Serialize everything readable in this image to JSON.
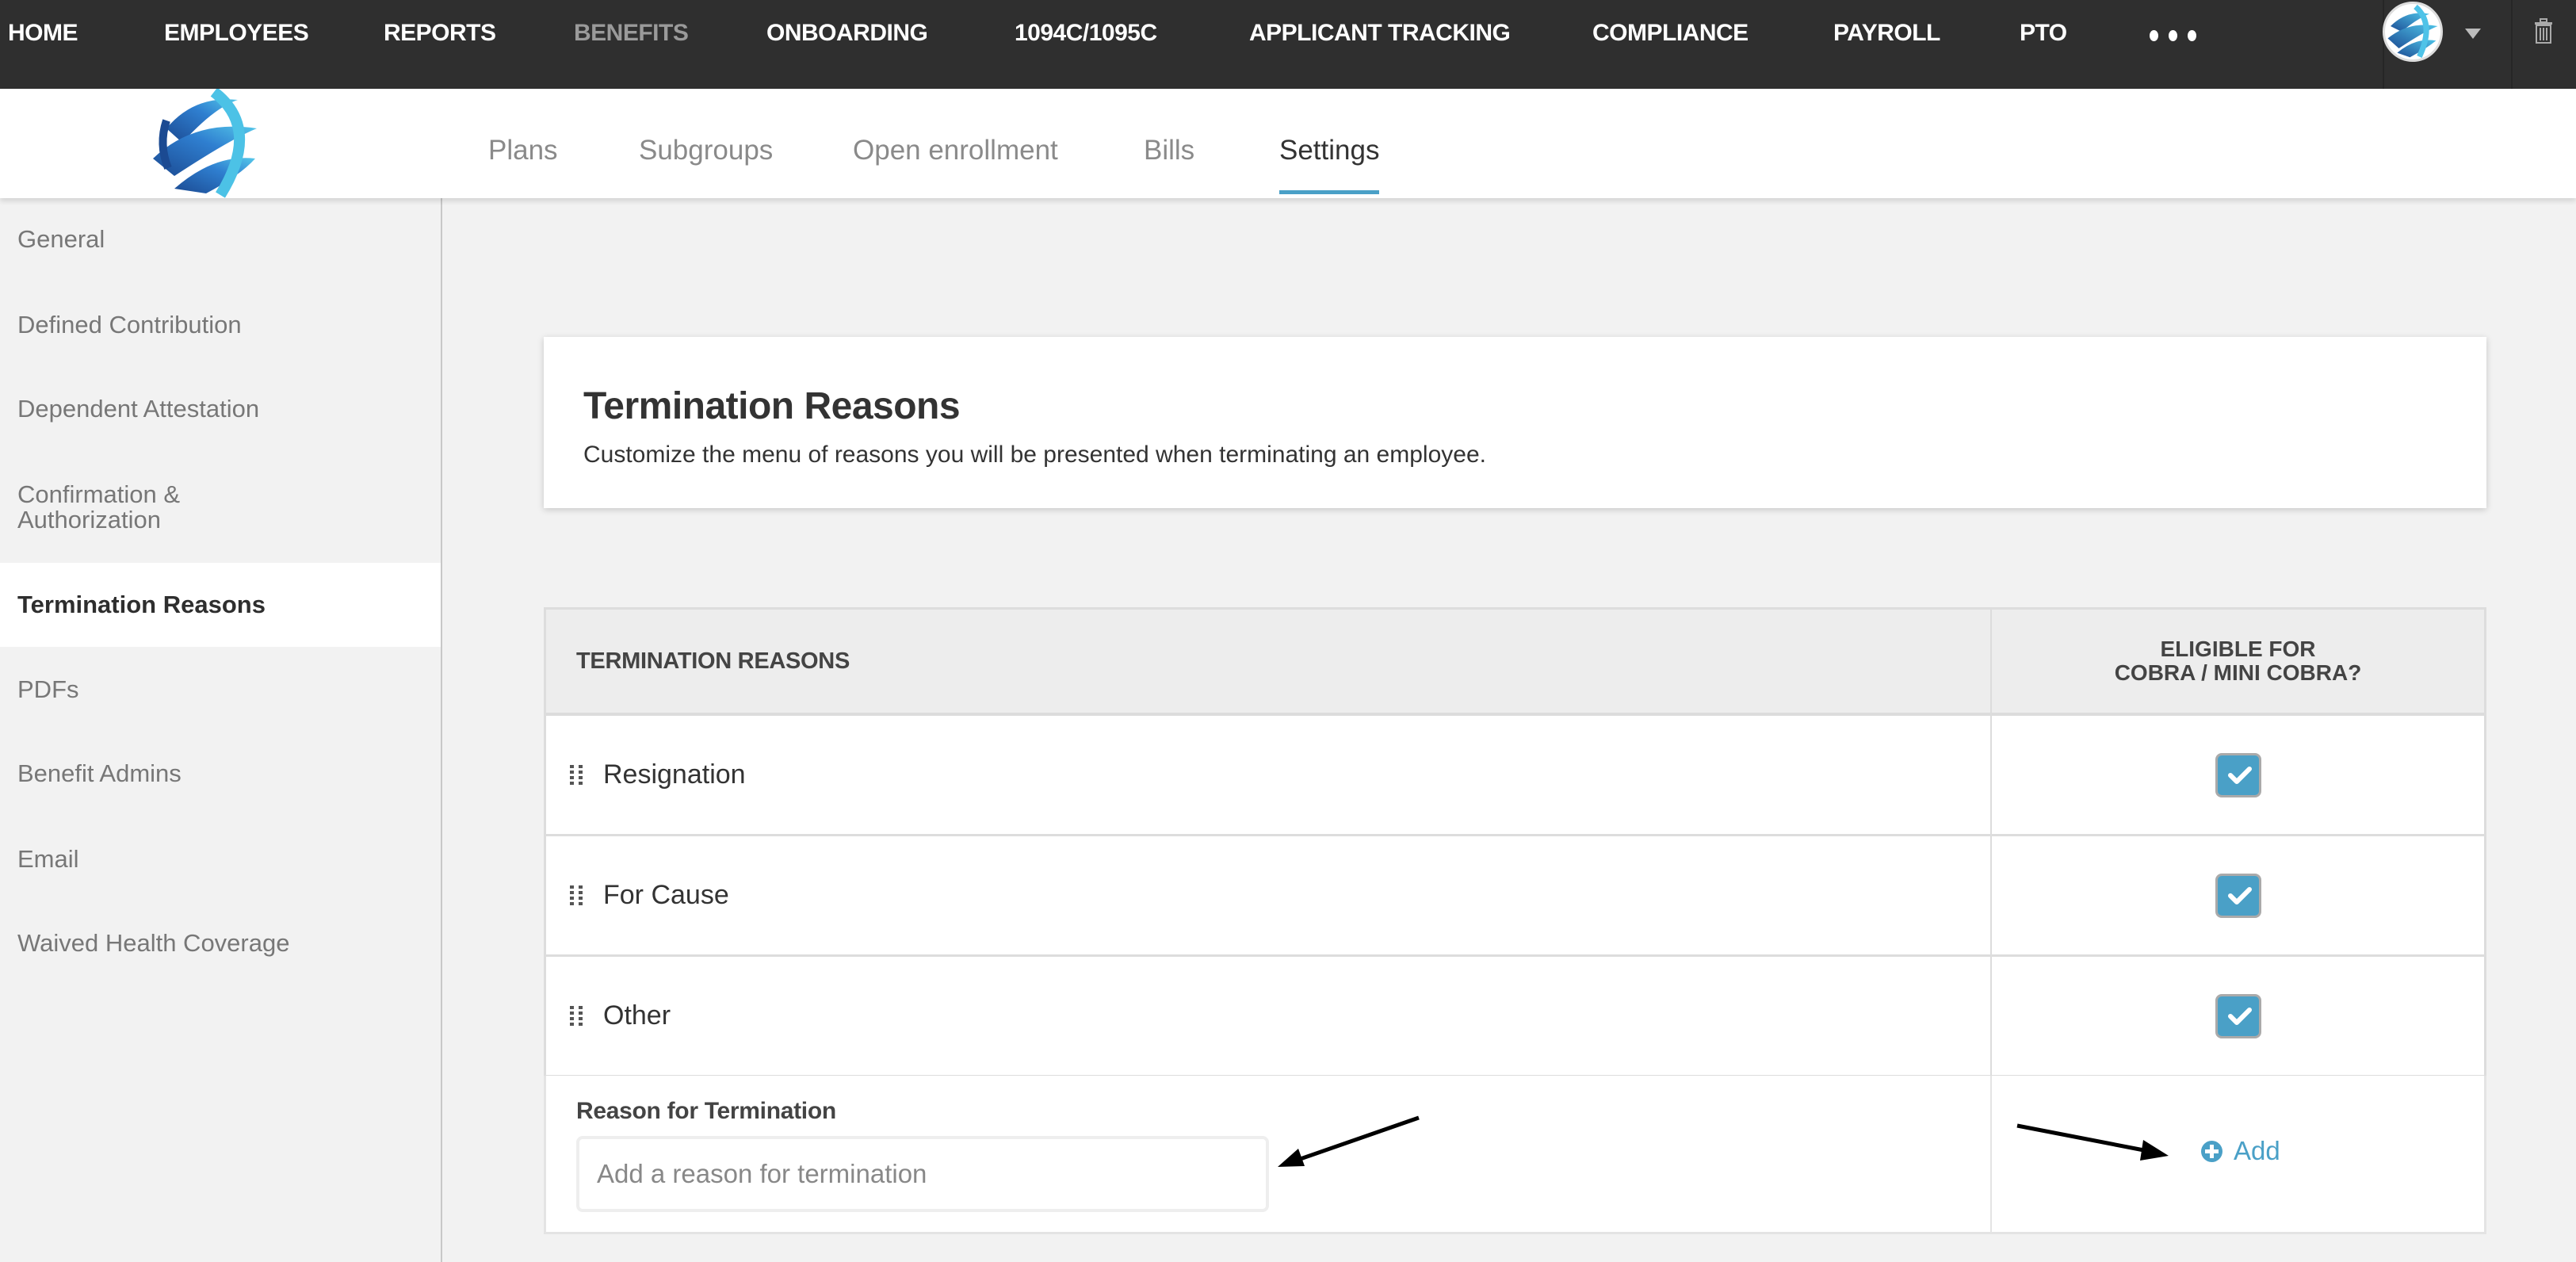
{
  "topnav": {
    "items": [
      {
        "label": "HOME",
        "active": false
      },
      {
        "label": "EMPLOYEES",
        "active": false
      },
      {
        "label": "REPORTS",
        "active": false
      },
      {
        "label": "BENEFITS",
        "active": true
      },
      {
        "label": "ONBOARDING",
        "active": false
      },
      {
        "label": "1094C/1095C",
        "active": false
      },
      {
        "label": "APPLICANT TRACKING",
        "active": false
      },
      {
        "label": "COMPLIANCE",
        "active": false
      },
      {
        "label": "PAYROLL",
        "active": false
      },
      {
        "label": "PTO",
        "active": false
      }
    ],
    "more_icon": "ellipsis-icon",
    "user_icon": "avatar-globe-icon",
    "dropdown_icon": "caret-down-icon",
    "trash_icon": "trash-icon"
  },
  "subnav": {
    "logo_icon": "globe-logo-icon",
    "tabs": [
      {
        "label": "Plans",
        "active": false
      },
      {
        "label": "Subgroups",
        "active": false
      },
      {
        "label": "Open enrollment",
        "active": false
      },
      {
        "label": "Bills",
        "active": false
      },
      {
        "label": "Settings",
        "active": true
      }
    ]
  },
  "sidebar": {
    "items": [
      {
        "label": "General",
        "active": false
      },
      {
        "label": "Defined Contribution",
        "active": false
      },
      {
        "label": "Dependent Attestation",
        "active": false
      },
      {
        "label": "Confirmation & Authorization",
        "active": false
      },
      {
        "label": "Termination Reasons",
        "active": true
      },
      {
        "label": "PDFs",
        "active": false
      },
      {
        "label": "Benefit Admins",
        "active": false
      },
      {
        "label": "Email",
        "active": false
      },
      {
        "label": "Waived Health Coverage",
        "active": false
      }
    ]
  },
  "header": {
    "title": "Termination Reasons",
    "description": "Customize the menu of reasons you will be presented when terminating an employee."
  },
  "table": {
    "columns": [
      "TERMINATION REASONS",
      "ELIGIBLE FOR",
      "COBRA / MINI COBRA?"
    ],
    "rows": [
      {
        "reason": "Resignation",
        "cobra_eligible": true
      },
      {
        "reason": "For Cause",
        "cobra_eligible": true
      },
      {
        "reason": "Other",
        "cobra_eligible": true
      }
    ]
  },
  "add_form": {
    "label": "Reason for Termination",
    "value": "",
    "placeholder": "Add a reason for termination",
    "add_label": "Add"
  },
  "colors": {
    "accent": "#4aa0c7",
    "topnav_bg": "#2f2f2f",
    "sidebar_bg": "#f2f2f2"
  }
}
